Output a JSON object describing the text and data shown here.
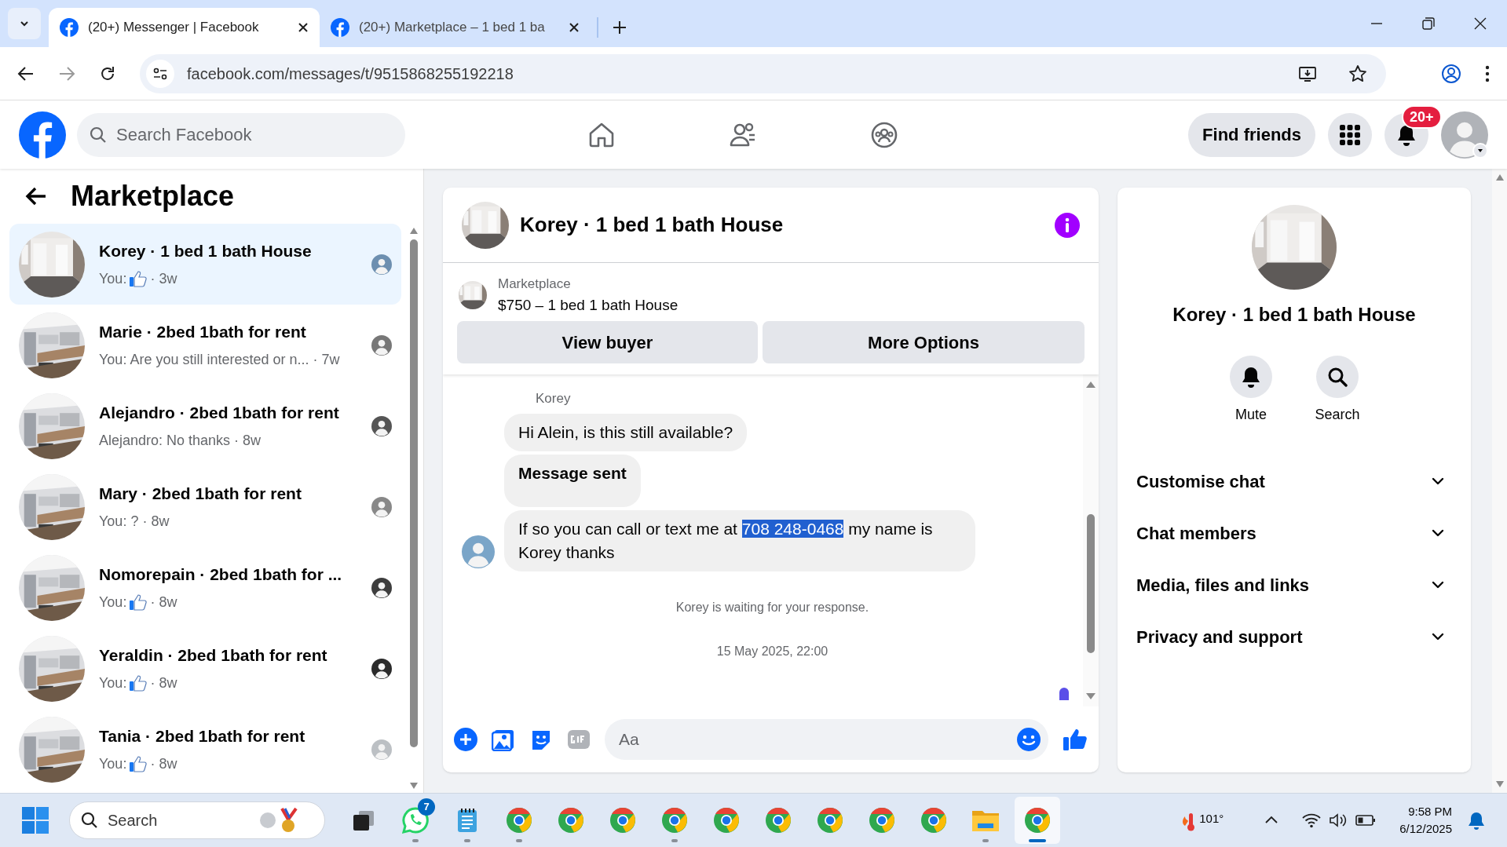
{
  "browser": {
    "tabs": [
      {
        "title": "(20+) Messenger | Facebook",
        "selected": true
      },
      {
        "title": "(20+) Marketplace – 1 bed 1 ba",
        "selected": false
      }
    ],
    "url": "facebook.com/messages/t/9515868255192218"
  },
  "header": {
    "search": {
      "placeholder": "Search Facebook"
    },
    "find_friends": "Find friends",
    "notification_badge": "20+"
  },
  "sidebar": {
    "title": "Marketplace",
    "conversations": [
      {
        "title": "Korey · 1 bed 1 bath House",
        "preview": "You:",
        "like": true,
        "time": "· 3w",
        "selected": true
      },
      {
        "title": "Marie · 2bed 1bath for rent",
        "preview": "You: Are you still interested or n...",
        "like": false,
        "time": "· 7w",
        "selected": false
      },
      {
        "title": "Alejandro · 2bed 1bath for rent",
        "preview": "Alejandro: No thanks",
        "like": false,
        "time": "· 8w",
        "selected": false
      },
      {
        "title": "Mary · 2bed 1bath for rent",
        "preview": "You: ?",
        "like": false,
        "time": "· 8w",
        "selected": false
      },
      {
        "title": "Nomorepain · 2bed 1bath for ...",
        "preview": "You:",
        "like": true,
        "time": "· 8w",
        "selected": false
      },
      {
        "title": "Yeraldin · 2bed 1bath for rent",
        "preview": "You:",
        "like": true,
        "time": "· 8w",
        "selected": false
      },
      {
        "title": "Tania · 2bed 1bath for rent",
        "preview": "You:",
        "like": true,
        "time": "· 8w",
        "selected": false
      }
    ]
  },
  "chat": {
    "title": "Korey · 1 bed 1 bath House",
    "listing": {
      "label": "Marketplace",
      "title": "$750 – 1 bed 1 bath House"
    },
    "buttons": [
      "View buyer",
      "More Options"
    ],
    "sender": "Korey",
    "messages": [
      {
        "kind": "text",
        "parts": [
          {
            "text": "Hi Alein, is this still available?",
            "highlighted": false
          }
        ]
      },
      {
        "kind": "bold",
        "parts": [
          {
            "text": "Message sent",
            "highlighted": false
          }
        ]
      },
      {
        "kind": "text",
        "parts": [
          {
            "text": "If so you can call or text me at ",
            "highlighted": false
          },
          {
            "text": "708 248-0468",
            "highlighted": true
          },
          {
            "text": " my name is Korey thanks",
            "highlighted": false
          }
        ]
      }
    ],
    "notice": "Korey is waiting for your response.",
    "timestamp": "15 May 2025, 22:00",
    "composer": {
      "placeholder": "Aa"
    }
  },
  "details": {
    "title": "Korey · 1 bed 1 bath House",
    "actions": [
      "Mute",
      "Search"
    ],
    "sections": [
      {
        "label": "Customise chat",
        "expanded": false
      },
      {
        "label": "Chat members",
        "expanded": false
      },
      {
        "label": "Media, files and links",
        "expanded": false
      },
      {
        "label": "Privacy and support",
        "expanded": false
      }
    ]
  },
  "taskbar": {
    "search": {
      "placeholder": "Search"
    },
    "apps": [
      {
        "kind": "taskview",
        "running": false,
        "selected": false
      },
      {
        "kind": "whatsapp",
        "badge": "7",
        "running": true,
        "selected": false
      },
      {
        "kind": "notepad",
        "running": true,
        "selected": false
      },
      {
        "kind": "chrome",
        "running": true,
        "selected": false
      },
      {
        "kind": "chrome",
        "running": false,
        "selected": false
      },
      {
        "kind": "chrome",
        "running": false,
        "selected": false
      },
      {
        "kind": "chrome",
        "running": true,
        "selected": false
      },
      {
        "kind": "chrome",
        "running": false,
        "selected": false
      },
      {
        "kind": "chrome",
        "running": false,
        "selected": false
      },
      {
        "kind": "chrome",
        "running": false,
        "selected": false
      },
      {
        "kind": "chrome",
        "running": false,
        "selected": false
      },
      {
        "kind": "chrome",
        "running": false,
        "selected": false
      },
      {
        "kind": "folder",
        "running": true,
        "selected": false
      },
      {
        "kind": "chrome",
        "running": true,
        "selected": true
      }
    ],
    "weather": "101°",
    "time": "9:58 PM",
    "date": "6/12/2025"
  }
}
